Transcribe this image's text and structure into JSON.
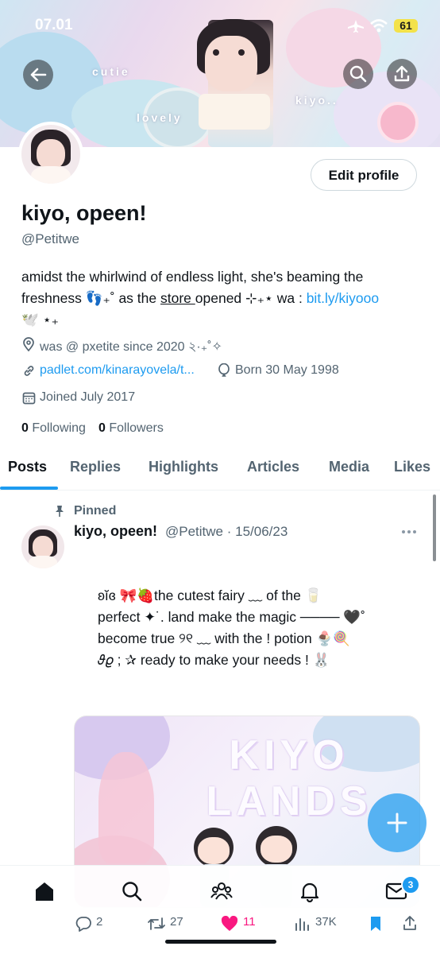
{
  "status_bar": {
    "time": "07.01",
    "battery": "61"
  },
  "banner": {
    "word1": "cutie",
    "word2": "lovely",
    "word3": "kiyo.."
  },
  "profile": {
    "edit_button": "Edit profile",
    "display_name": "kiyo, opeen!",
    "handle": "@Petitwe",
    "bio_line1": "amidst the whirlwind of endless light, she's beaming the",
    "bio_line2_a": "freshness 👣₊˚ as the ",
    "bio_line2_store": "store ",
    "bio_line2_b": "opened ⊹₊⋆ wa : ",
    "bio_link": "bit.ly/kiyooo",
    "bio_line3": "🕊️ ⋆₊",
    "location": "was @ pxetite since 2020 ২·₊˚✧",
    "website": "padlet.com/kinarayovela/t...",
    "birthday": "Born 30 May 1998",
    "joined": "Joined July 2017",
    "following_count": "0",
    "following_label": "Following",
    "followers_count": "0",
    "followers_label": "Followers"
  },
  "tabs": [
    "Posts",
    "Replies",
    "Highlights",
    "Articles",
    "Media",
    "Likes"
  ],
  "post": {
    "pinned_label": "Pinned",
    "author": "kiyo, opeen!",
    "handle_date": "@Petitwe · 15/06/23",
    "lines": [
      "ʚĭɞ 🎀🍓the cutest  fairy ﹏  of the 🥛",
      "perfect ✦˙. land  make the magic ──── 🖤˚",
      "become true ୨୧ ﹏ with the ! potion 🍨🍭",
      "𝜗𝜚 ; ✰  ready  to  make  your  needs  ! 🐰"
    ],
    "image_text": "KIYO LANDS",
    "replies": "2",
    "reposts": "27",
    "likes": "11",
    "views": "37K"
  },
  "bottom_nav": {
    "messages_badge": "3"
  },
  "colors": {
    "accent": "#1d9bf0",
    "like": "#f91880",
    "muted": "#536471"
  }
}
